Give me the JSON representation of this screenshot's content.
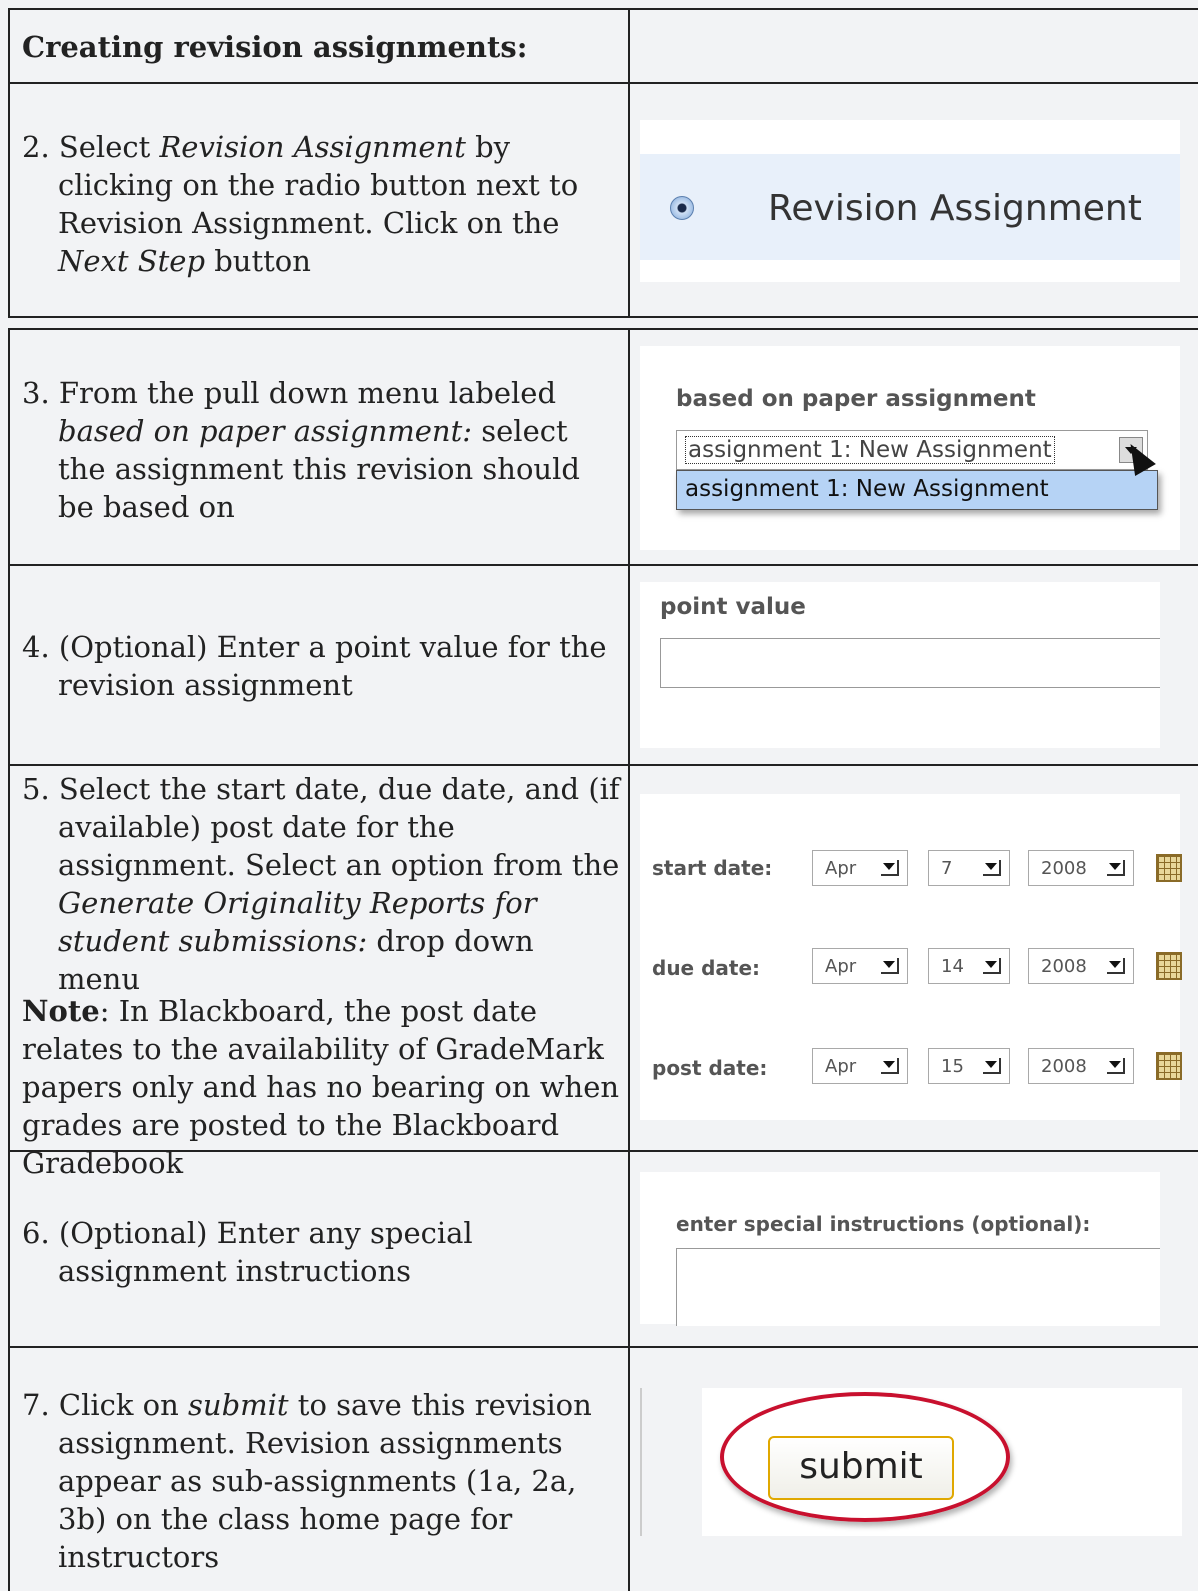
{
  "header": {
    "title": "Creating revision assignments:"
  },
  "steps": {
    "s2": {
      "parts": [
        "2. Select ",
        "Revision Assignment",
        " by clicking on the radio button next to Revision Assignment. Click on the ",
        "Next Step",
        " button"
      ],
      "ui": {
        "radio_label": "Revision Assignment"
      }
    },
    "s3": {
      "parts": [
        "3. From the pull down menu labeled ",
        "based on paper assignment:",
        " select the assignment this revision should be based on"
      ],
      "ui": {
        "field_label": "based on paper assignment",
        "selected": "assignment 1: New Assignment",
        "option": "assignment 1: New Assignment"
      }
    },
    "s4": {
      "text": "4. (Optional) Enter a point value for the revision assignment",
      "ui": {
        "field_label": "point value",
        "value": ""
      }
    },
    "s5": {
      "parts": [
        "5. Select the start date, due date, and (if available) post date for the assignment. Select an option from the ",
        "Generate Originality Reports for student submissions:",
        " drop down menu"
      ],
      "note_label": "Note",
      "note_text": ": In Blackboard, the post date relates to the availability of GradeMark papers only and has no bearing on when grades are posted to the Blackboard Gradebook",
      "ui": {
        "start_label": "start date:",
        "start_month": "Apr",
        "start_day": "7",
        "start_year": "2008",
        "due_label": "due date:",
        "due_month": "Apr",
        "due_day": "14",
        "due_year": "2008",
        "post_label": "post date:",
        "post_month": "Apr",
        "post_day": "15",
        "post_year": "2008"
      }
    },
    "s6": {
      "text": "6. (Optional) Enter any special assignment instructions",
      "ui": {
        "field_label": "enter special instructions (optional):"
      }
    },
    "s7": {
      "parts": [
        "7. Click on ",
        "submit",
        " to save this revision assignment. Revision assignments appear as sub-assignments (1a, 2a, 3b) on the class home page for instructors"
      ],
      "ui": {
        "button_label": "submit"
      }
    }
  }
}
